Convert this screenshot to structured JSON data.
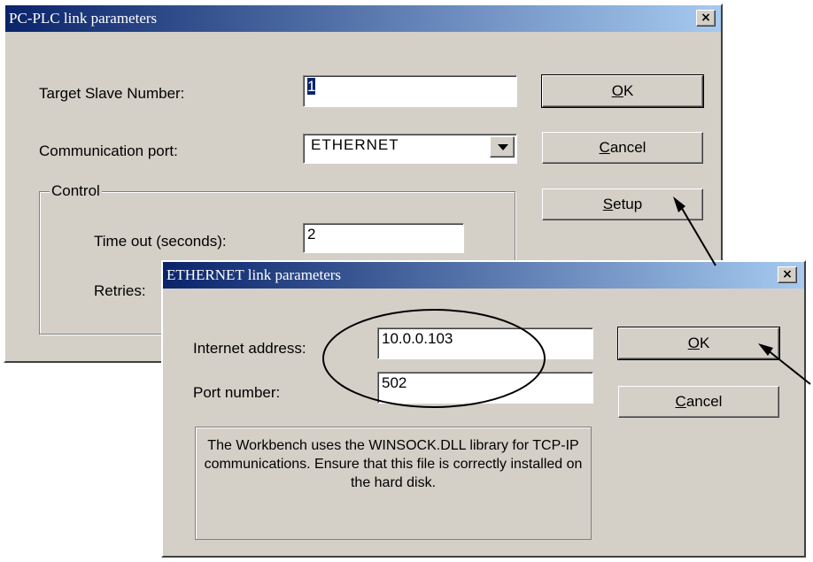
{
  "back_dialog": {
    "title": "PC-PLC link parameters",
    "close_label": "×",
    "target_slave_label": "Target Slave Number:",
    "target_slave_value": "1",
    "comm_port_label": "Communication port:",
    "comm_port_value": "ETHERNET",
    "control_group_label": "Control",
    "timeout_label": "Time out (seconds):",
    "timeout_value": "2",
    "retries_label": "Retries:",
    "ok_mnemonic": "O",
    "ok_rest": "K",
    "cancel_mnemonic": "C",
    "cancel_rest": "ancel",
    "setup_mnemonic": "S",
    "setup_rest": "etup"
  },
  "front_dialog": {
    "title": "ETHERNET link parameters",
    "close_label": "×",
    "internet_address_label": "Internet address:",
    "internet_address_value": "10.0.0.103",
    "port_number_label": "Port number:",
    "port_number_value": "502",
    "note_text": "The Workbench uses the WINSOCK.DLL library for TCP-IP communications. Ensure that this file is correctly installed on the hard disk.",
    "ok_mnemonic": "O",
    "ok_rest": "K",
    "cancel_mnemonic": "C",
    "cancel_rest": "ancel"
  },
  "colors": {
    "title_gradient_start": "#0a246a",
    "title_gradient_end": "#a6caf0",
    "dialog_face": "#d4d0c8"
  }
}
